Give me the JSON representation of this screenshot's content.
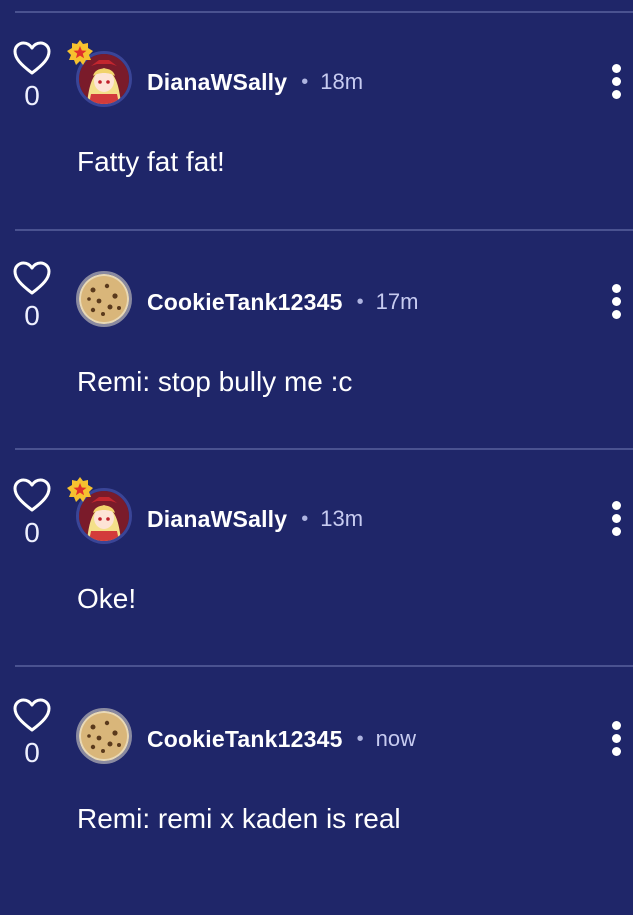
{
  "comments": [
    {
      "likes": "0",
      "username": "DianaWSally",
      "separator": "•",
      "time": "18m",
      "text": "Fatty fat fat!",
      "avatar_icon": "anime-girl-avatar",
      "has_badge": true
    },
    {
      "likes": "0",
      "username": "CookieTank12345",
      "separator": "•",
      "time": "17m",
      "text": "Remi: stop bully me :c",
      "avatar_icon": "cookie-avatar",
      "has_badge": false
    },
    {
      "likes": "0",
      "username": "DianaWSally",
      "separator": "•",
      "time": "13m",
      "text": "Oke!",
      "avatar_icon": "anime-girl-avatar",
      "has_badge": true
    },
    {
      "likes": "0",
      "username": "CookieTank12345",
      "separator": "•",
      "time": "now",
      "text": "Remi: remi x kaden is real",
      "avatar_icon": "cookie-avatar",
      "has_badge": false
    }
  ],
  "colors": {
    "background": "#1f2669",
    "divider": "#4a5290",
    "text": "#ffffff",
    "badge": "#f6c12f",
    "badge_star": "#e0302a"
  }
}
